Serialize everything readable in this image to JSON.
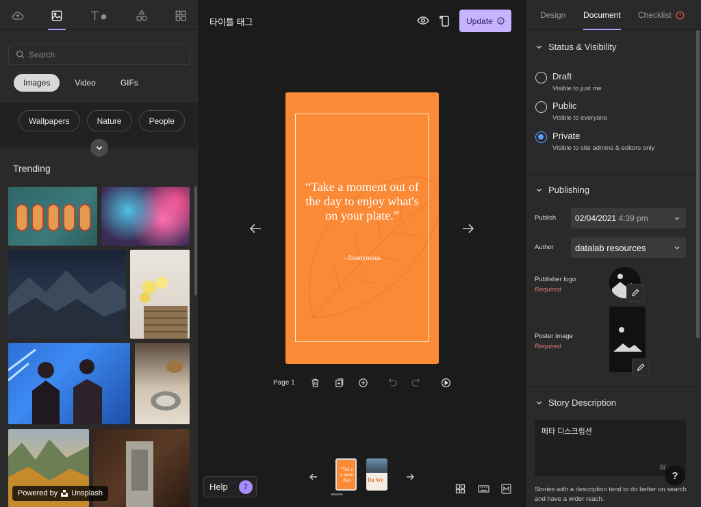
{
  "left_panel": {
    "search_placeholder": "Search",
    "media_types": [
      "Images",
      "Video",
      "GIFs"
    ],
    "categories": [
      "Wallpapers",
      "Nature",
      "People"
    ],
    "trending_label": "Trending",
    "powered_by": "Powered by",
    "unsplash": "Unsplash"
  },
  "header": {
    "doc_title": "타이틀 태그",
    "update_label": "Update"
  },
  "story": {
    "quote": "“Take a moment out of the day to enjoy what's on your plate.”",
    "author": "- Anonymous"
  },
  "page_bar": {
    "page_label": "Page 1"
  },
  "bottom": {
    "help_label": "Help",
    "help_count": "7",
    "thumb1_text": "“Tak e a mom Ano",
    "thumb2_text": "Da We"
  },
  "right_panel": {
    "tabs": [
      "Design",
      "Document",
      "Checklist"
    ],
    "status_section": "Status & Visibility",
    "visibility": [
      {
        "label": "Draft",
        "sub": "Visible to just me"
      },
      {
        "label": "Public",
        "sub": "Visible to everyone"
      },
      {
        "label": "Private",
        "sub": "Visible to site admins & editors only"
      }
    ],
    "selected_visibility": "Private",
    "publishing_section": "Publishing",
    "publish_label": "Publish",
    "publish_date": "02/04/2021",
    "publish_time": "4:39 pm",
    "author_label": "Author",
    "author_value": "datalab resources",
    "publisher_logo_label": "Publisher logo",
    "poster_image_label": "Poster image",
    "required_label": "Required",
    "description_section": "Story Description",
    "description_value": "메타 디스크립션",
    "description_count": "8/",
    "description_hint": "Stories with a description tend to do better on search and have a wider reach."
  },
  "colors": {
    "accent": "#c7b3ff",
    "story_bg": "#fb8a37",
    "radio_selected": "#5aa0ff",
    "required": "#e07a7a"
  }
}
